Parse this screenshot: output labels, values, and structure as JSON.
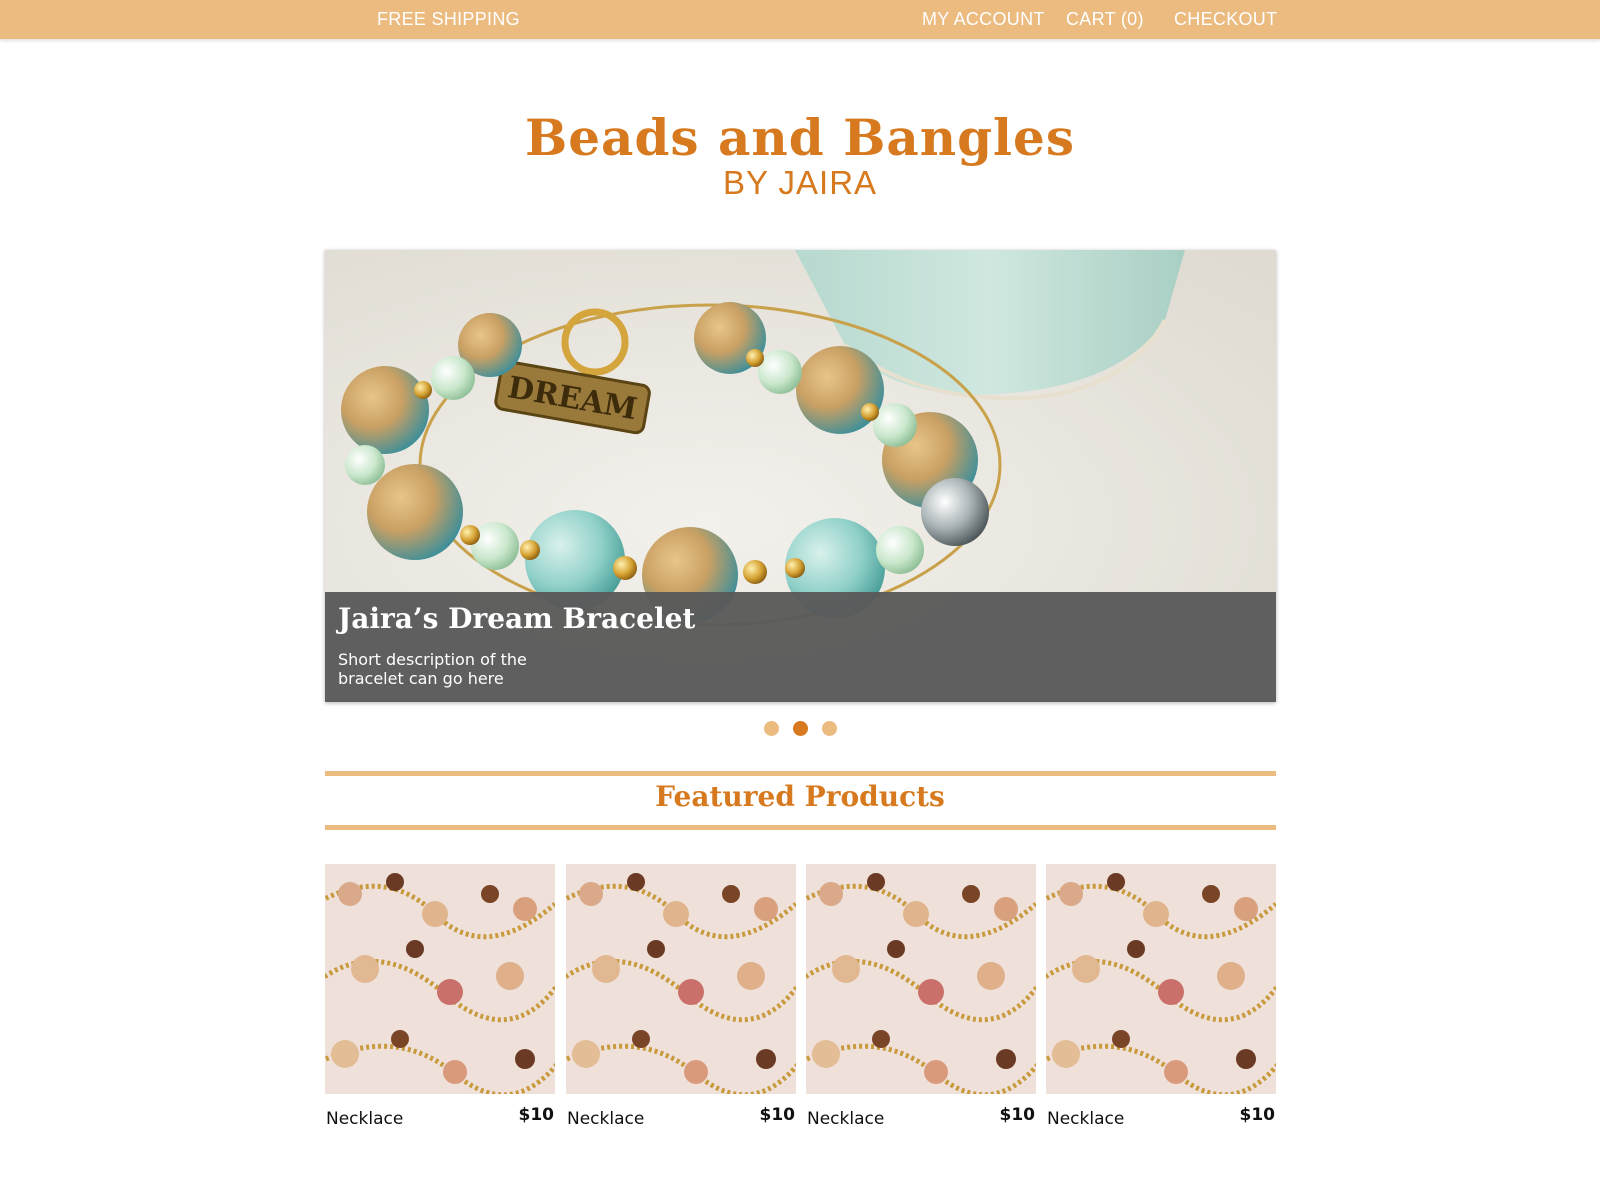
{
  "topbar": {
    "free_shipping": "FREE SHIPPING",
    "my_account": "MY ACCOUNT",
    "cart": "CART (0)",
    "checkout": "CHECKOUT"
  },
  "logo": {
    "title": "Beads and Bangles",
    "subtitle": "BY JAIRA"
  },
  "hero": {
    "title": "Jaira’s Dream Bracelet",
    "description": "Short description of the bracelet can go here",
    "charm_text": "DREAM",
    "active_slide": 2,
    "slide_count": 3
  },
  "featured": {
    "title": "Featured Products",
    "products": [
      {
        "name": "Necklace",
        "price": "$10"
      },
      {
        "name": "Necklace",
        "price": "$10"
      },
      {
        "name": "Necklace",
        "price": "$10"
      },
      {
        "name": "Necklace",
        "price": "$10"
      }
    ]
  },
  "colors": {
    "accent": "#ebbb80",
    "brand": "#d6791f",
    "caption_bg": "#5a5a5a"
  },
  "icons": [
    "slide-dot-icon"
  ]
}
